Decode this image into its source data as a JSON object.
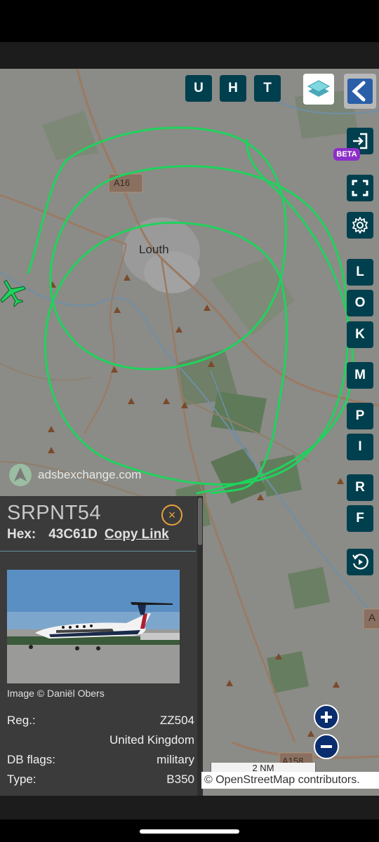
{
  "map": {
    "town_label": "Louth",
    "road_labels": [
      "A16",
      "A158",
      "A"
    ],
    "watermark": "adsbexchange.com",
    "scale_label": "2 NM",
    "attribution": "© OpenStreetMap contributors.",
    "track_color": "#1fd35c",
    "aircraft_color": "#1fd35c"
  },
  "toolbar": {
    "top_buttons": [
      "U",
      "H",
      "T"
    ],
    "beta_label": "BETA",
    "side_letters": [
      "L",
      "O",
      "K",
      "M",
      "P",
      "I",
      "R",
      "F"
    ],
    "icons": [
      "layers-icon",
      "back-chevron-icon",
      "login-icon",
      "fullscreen-icon",
      "gear-icon",
      "replay-icon",
      "zoom-in-icon",
      "zoom-out-icon"
    ]
  },
  "panel": {
    "callsign": "SRPNT54",
    "close_glyph": "×",
    "hex_label": "Hex:",
    "hex_value": "43C61D",
    "copy_link": "Copy Link",
    "image_caption": "Image © Daniël Obers",
    "rows": [
      {
        "label": "Reg.:",
        "value": "ZZ504"
      },
      {
        "label": "",
        "value": "United Kingdom"
      },
      {
        "label": "DB flags:",
        "value": "military"
      },
      {
        "label": "Type:",
        "value": "B350"
      }
    ]
  }
}
